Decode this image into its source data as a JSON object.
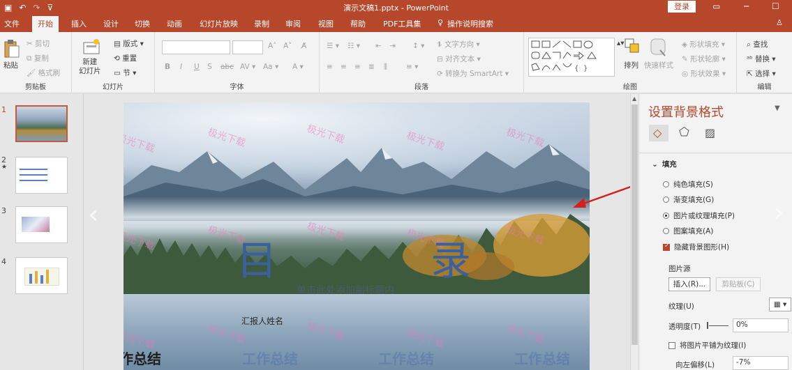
{
  "titlebar": {
    "title": "演示文稿1.pptx - PowerPoint",
    "login": "登录",
    "qat_icons": [
      "save-icon",
      "undo-icon",
      "redo-icon",
      "customize-icon"
    ]
  },
  "tabs": [
    "文件",
    "开始",
    "插入",
    "设计",
    "切换",
    "动画",
    "幻灯片放映",
    "录制",
    "审阅",
    "视图",
    "帮助",
    "PDF工具集"
  ],
  "tell_me": "操作说明搜索",
  "ribbon": {
    "clipboard": {
      "label": "剪贴板",
      "paste": "粘贴",
      "cut": "剪切",
      "copy": "复制",
      "format_painter": "格式刷"
    },
    "slides": {
      "label": "幻灯片",
      "new_slide": "新建\n幻灯片",
      "layout": "版式",
      "reset": "重置",
      "section": "节"
    },
    "font": {
      "label": "字体"
    },
    "paragraph": {
      "label": "段落",
      "text_direction": "文字方向",
      "align_text": "对齐文本",
      "smartart": "转换为 SmartArt"
    },
    "drawing": {
      "label": "绘图",
      "arrange": "排列",
      "quick_styles": "快速样式",
      "shape_fill": "形状填充",
      "shape_outline": "形状轮廓",
      "shape_effects": "形状效果"
    },
    "editing": {
      "label": "编辑",
      "find": "查找",
      "replace": "替换",
      "select": "选择"
    }
  },
  "slides_panel": {
    "numbers": [
      "1",
      "2",
      "3",
      "4"
    ]
  },
  "slide": {
    "watermark": "极光下载",
    "title_left": "目",
    "title_right": "录",
    "subtitle_placeholder": "单击此处添加副标题内",
    "reporter": "汇报人姓名",
    "work_summary": "工作总结"
  },
  "pane": {
    "title": "设置背景格式",
    "tab_icons": [
      "fill-icon",
      "effects-icon",
      "picture-icon"
    ],
    "fill_header": "填充",
    "options": [
      {
        "label": "纯色填充(S)",
        "selected": false
      },
      {
        "label": "渐变填充(G)",
        "selected": false
      },
      {
        "label": "图片或纹理填充(P)",
        "selected": true
      },
      {
        "label": "图案填充(A)",
        "selected": false
      }
    ],
    "hide_bg": "隐藏背景图形(H)",
    "picture_source": "图片源",
    "insert": "插入(R)...",
    "clipboard": "剪贴板(C)",
    "texture": "纹理(U)",
    "transparency_label": "透明度(T)",
    "transparency_value": "0%",
    "tile": "将图片平铺为纹理(I)",
    "offset_left_label": "向左偏移(L)",
    "offset_left_value": "-7%"
  },
  "colors": {
    "accent": "#b7472a",
    "title_text": "#3c5f9e",
    "annotation_arrow": "#d62020"
  }
}
